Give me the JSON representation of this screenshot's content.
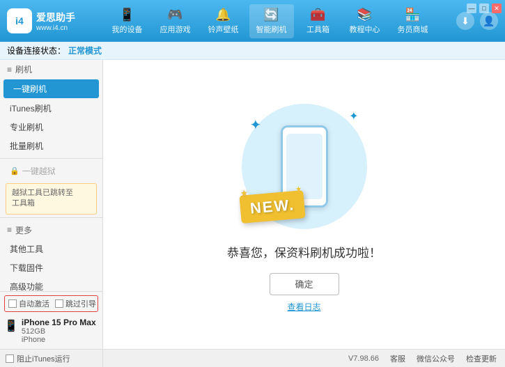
{
  "app": {
    "logo_main": "爱思助手",
    "logo_sub": "www.i4.cn",
    "logo_char": "i4"
  },
  "header": {
    "tabs": [
      {
        "id": "my-device",
        "label": "我的设备",
        "icon": "📱"
      },
      {
        "id": "apps",
        "label": "应用游戏",
        "icon": "👤"
      },
      {
        "id": "ringtone",
        "label": "铃声壁纸",
        "icon": "🎵"
      },
      {
        "id": "smart-flash",
        "label": "智能刷机",
        "icon": "🔄"
      },
      {
        "id": "toolbox",
        "label": "工具箱",
        "icon": "🧰"
      },
      {
        "id": "tutorial",
        "label": "教程中心",
        "icon": "🎓"
      },
      {
        "id": "store",
        "label": "务员商城",
        "icon": "🏪"
      }
    ],
    "download_btn": "⬇",
    "user_btn": "👤"
  },
  "status_bar": {
    "prefix": "设备连接状态：",
    "status": "正常模式"
  },
  "sidebar": {
    "section1_label": "刷机",
    "items": [
      {
        "id": "one-click-flash",
        "label": "一键刷机",
        "active": true
      },
      {
        "id": "itunes-flash",
        "label": "iTunes刷机"
      },
      {
        "id": "pro-flash",
        "label": "专业刷机"
      },
      {
        "id": "batch-flash",
        "label": "批量刷机"
      }
    ],
    "disabled_label": "一键越狱",
    "notice_text": "越狱工具已跳转至\n工具箱",
    "section2_label": "更多",
    "more_items": [
      {
        "id": "other-tools",
        "label": "其他工具"
      },
      {
        "id": "download-firmware",
        "label": "下载固件"
      },
      {
        "id": "advanced",
        "label": "高级功能"
      }
    ]
  },
  "bottom_sidebar": {
    "auto_activate_label": "自动激活",
    "guide_label": "跳过引导",
    "device_name": "iPhone 15 Pro Max",
    "device_storage": "512GB",
    "device_type": "iPhone"
  },
  "content": {
    "success_text": "恭喜您，保资料刷机成功啦！",
    "confirm_btn": "确定",
    "log_link": "查看日志"
  },
  "footer": {
    "itunes_label": "阻止iTunes运行",
    "version": "V7.98.66",
    "items": [
      "客服",
      "微信公众号",
      "检查更新"
    ]
  },
  "win_controls": [
    "—",
    "□",
    "✕"
  ]
}
